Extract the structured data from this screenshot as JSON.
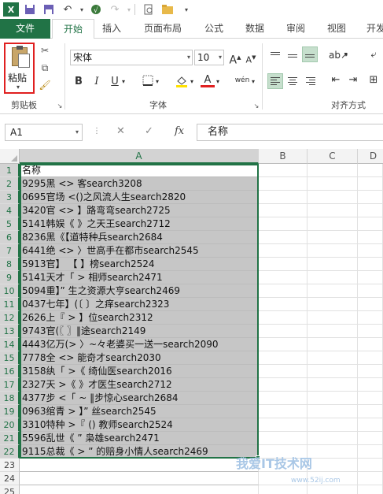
{
  "qat": {
    "icons": [
      "excel-logo-icon",
      "save-icon",
      "save-as-icon",
      "undo-icon",
      "touch-mode-icon",
      "redo-icon",
      "print-preview-icon",
      "open-folder-icon"
    ]
  },
  "tabs": [
    "文件",
    "开始",
    "插入",
    "页面布局",
    "公式",
    "数据",
    "审阅",
    "视图",
    "开发"
  ],
  "ribbon": {
    "paste_label": "粘贴",
    "clipboard_label": "剪贴板",
    "font_name": "宋体",
    "font_size": "10",
    "font_group_label": "字体",
    "align_group_label": "对齐方式",
    "bold": "B",
    "italic": "I",
    "underline": "U",
    "phonetic": "wén",
    "font_color_letter": "A",
    "grow_font": "A",
    "shrink_font": "A"
  },
  "formula_bar": {
    "name_box": "A1",
    "fx": "fx",
    "content": "名称"
  },
  "columns": [
    "A",
    "B",
    "C",
    "D"
  ],
  "rows": [
    {
      "n": "1",
      "a": "名称"
    },
    {
      "n": "2",
      "a": "9295黑 <> 客search3208"
    },
    {
      "n": "3",
      "a": "0695官场 <()之风流人生search2820"
    },
    {
      "n": "4",
      "a": "3420官 <> 】路弯弯search2725"
    },
    {
      "n": "5",
      "a": "5141韩娱《 》之天王search2712"
    },
    {
      "n": "6",
      "a": "8236黑《【道特种兵search2684"
    },
    {
      "n": "7",
      "a": "6441绝 <> 〉世高手在都市search2545"
    },
    {
      "n": "8",
      "a": "5913官】 【 】榜search2524"
    },
    {
      "n": "9",
      "a": "5141天才「 > 相师search2471"
    },
    {
      "n": "10",
      "a": "5094重】” 生之资源大亨search2469"
    },
    {
      "n": "11",
      "a": "0437七年】(〔 〕之痒search2323"
    },
    {
      "n": "12",
      "a": "2626上『 > 】位search2312"
    },
    {
      "n": "13",
      "a": "9743官(〖 〗‖途search2149"
    },
    {
      "n": "14",
      "a": "4443亿万(> 〉~々老婆买一送一search2090"
    },
    {
      "n": "15",
      "a": "7778全 <> 能奇才search2030"
    },
    {
      "n": "16",
      "a": "3158纨「 >《 绮仙医search2016"
    },
    {
      "n": "17",
      "a": "2327天 >《 》才医生search2712"
    },
    {
      "n": "18",
      "a": "4377步 <「 ~ ‖步惊心search2684"
    },
    {
      "n": "19",
      "a": "0963绾青 > 】” 丝search2545"
    },
    {
      "n": "20",
      "a": "3310特种 >『 () 教师search2524"
    },
    {
      "n": "21",
      "a": "5596乱世《 ” 枭雄search2471"
    },
    {
      "n": "22",
      "a": "9115总裁《 > ” 的赔身小情人search2469"
    },
    {
      "n": "23",
      "a": ""
    },
    {
      "n": "24",
      "a": ""
    },
    {
      "n": "25",
      "a": ""
    }
  ],
  "watermark": {
    "text": "我爱IT技术网",
    "url": "www.52ij.com"
  }
}
